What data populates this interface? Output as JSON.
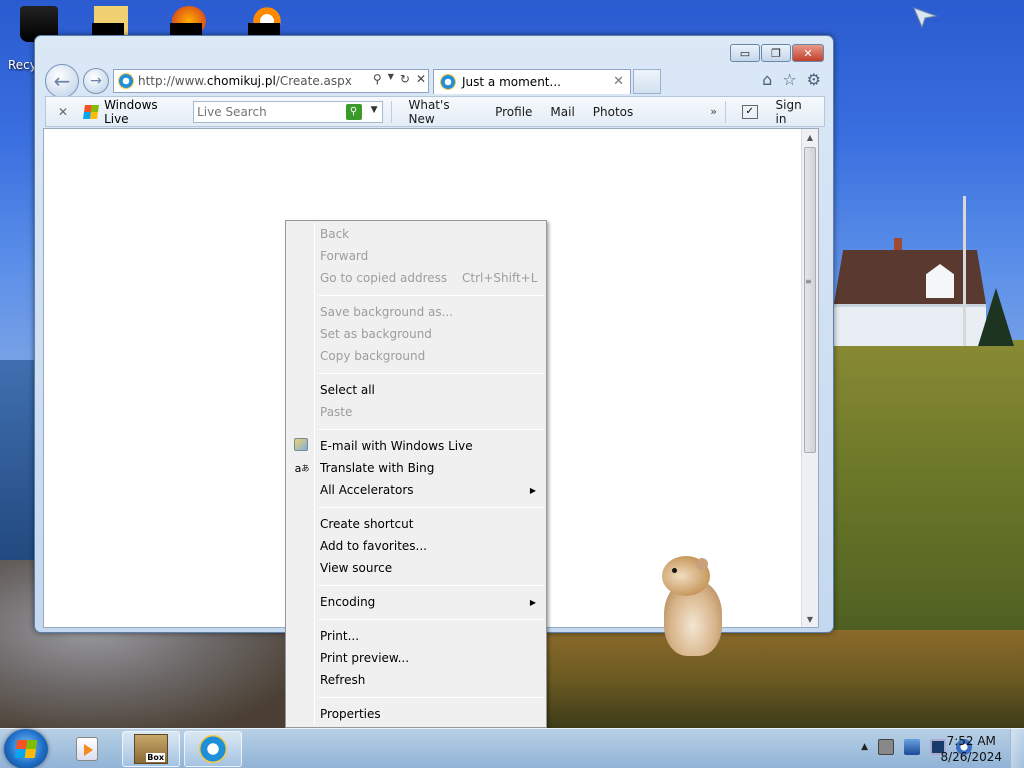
{
  "desktop": {
    "recycle_label": "Recy"
  },
  "browser": {
    "address_prefix": "http://www.",
    "address_domain": "chomikuj.pl",
    "address_suffix": "/Create.aspx",
    "tab_title": "Just a moment...",
    "window_controls": {
      "minimize": "▭",
      "restore": "❐",
      "close": "✕"
    }
  },
  "toolbar": {
    "close_label": "✕",
    "windows_live_label": "Windows Live",
    "search_placeholder": "Live Search",
    "links": [
      "What's New",
      "Profile",
      "Mail",
      "Photos"
    ],
    "more": "»",
    "signin_label": "Sign in"
  },
  "context_menu": {
    "groups": [
      [
        {
          "label": "Back",
          "disabled": true
        },
        {
          "label": "Forward",
          "disabled": true
        },
        {
          "label": "Go to copied address",
          "shortcut": "Ctrl+Shift+L",
          "disabled": true
        }
      ],
      [
        {
          "label": "Save background as...",
          "disabled": true
        },
        {
          "label": "Set as background",
          "disabled": true
        },
        {
          "label": "Copy background",
          "disabled": true
        }
      ],
      [
        {
          "label": "Select all",
          "disabled": false
        },
        {
          "label": "Paste",
          "disabled": true
        }
      ],
      [
        {
          "label": "E-mail with Windows Live",
          "disabled": false,
          "icon": "email-icon"
        },
        {
          "label": "Translate with Bing",
          "disabled": false,
          "icon": "translate-icon"
        },
        {
          "label": "All Accelerators",
          "disabled": false,
          "submenu": true
        }
      ],
      [
        {
          "label": "Create shortcut",
          "disabled": false
        },
        {
          "label": "Add to favorites...",
          "disabled": false
        },
        {
          "label": "View source",
          "disabled": false
        }
      ],
      [
        {
          "label": "Encoding",
          "disabled": false,
          "submenu": true
        }
      ],
      [
        {
          "label": "Print...",
          "disabled": false
        },
        {
          "label": "Print preview...",
          "disabled": false
        },
        {
          "label": "Refresh",
          "disabled": false
        }
      ],
      [
        {
          "label": "Properties",
          "disabled": false
        }
      ]
    ]
  },
  "taskbar": {
    "box_label": "Box",
    "time": "7:52 AM",
    "date": "8/26/2024"
  }
}
